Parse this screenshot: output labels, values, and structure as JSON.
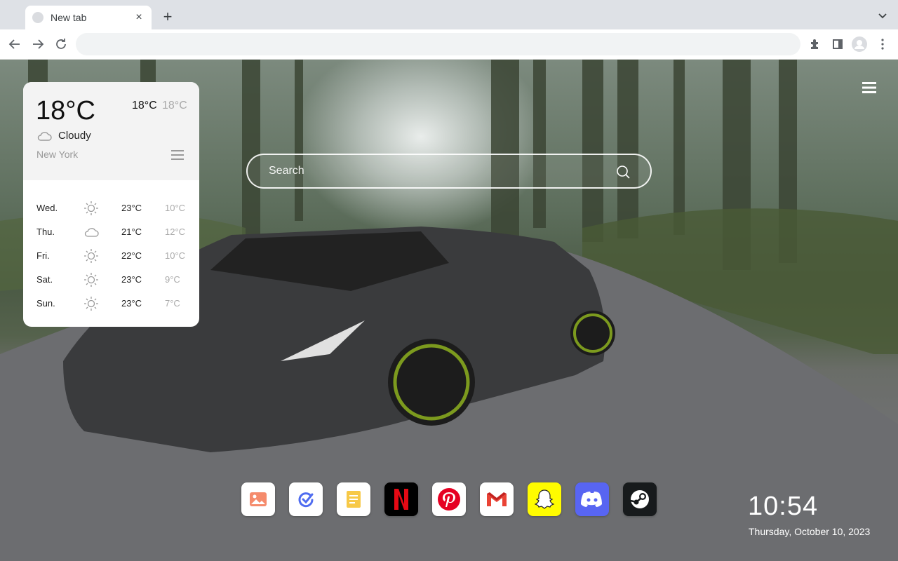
{
  "browser": {
    "tab_title": "New tab",
    "omnibox_value": ""
  },
  "weather": {
    "current_temp": "18°C",
    "high": "18°C",
    "low": "18°C",
    "condition": "Cloudy",
    "condition_icon": "cloud-icon",
    "city": "New York",
    "forecast": [
      {
        "day": "Wed.",
        "icon": "sun-icon",
        "high": "23°C",
        "low": "10°C"
      },
      {
        "day": "Thu.",
        "icon": "cloud-icon",
        "high": "21°C",
        "low": "12°C"
      },
      {
        "day": "Fri.",
        "icon": "sun-icon",
        "high": "22°C",
        "low": "10°C"
      },
      {
        "day": "Sat.",
        "icon": "sun-icon",
        "high": "23°C",
        "low": "9°C"
      },
      {
        "day": "Sun.",
        "icon": "sun-icon",
        "high": "23°C",
        "low": "7°C"
      }
    ]
  },
  "search": {
    "placeholder": "Search"
  },
  "dock": {
    "apps": [
      {
        "name": "photos",
        "icon": "photo-icon",
        "bg": "#ffffff"
      },
      {
        "name": "tasks",
        "icon": "check-icon",
        "bg": "#ffffff"
      },
      {
        "name": "notes",
        "icon": "notes-icon",
        "bg": "#ffffff"
      },
      {
        "name": "netflix",
        "icon": "netflix-icon",
        "bg": "#000000"
      },
      {
        "name": "pinterest",
        "icon": "pinterest-icon",
        "bg": "#ffffff"
      },
      {
        "name": "gmail",
        "icon": "gmail-icon",
        "bg": "#ffffff"
      },
      {
        "name": "snapchat",
        "icon": "snapchat-icon",
        "bg": "#fffc00"
      },
      {
        "name": "discord",
        "icon": "discord-icon",
        "bg": "#5865f2"
      },
      {
        "name": "steam",
        "icon": "steam-icon",
        "bg": "#171a1c"
      }
    ]
  },
  "clock": {
    "time": "10:54",
    "date": "Thursday, October 10, 2023"
  }
}
